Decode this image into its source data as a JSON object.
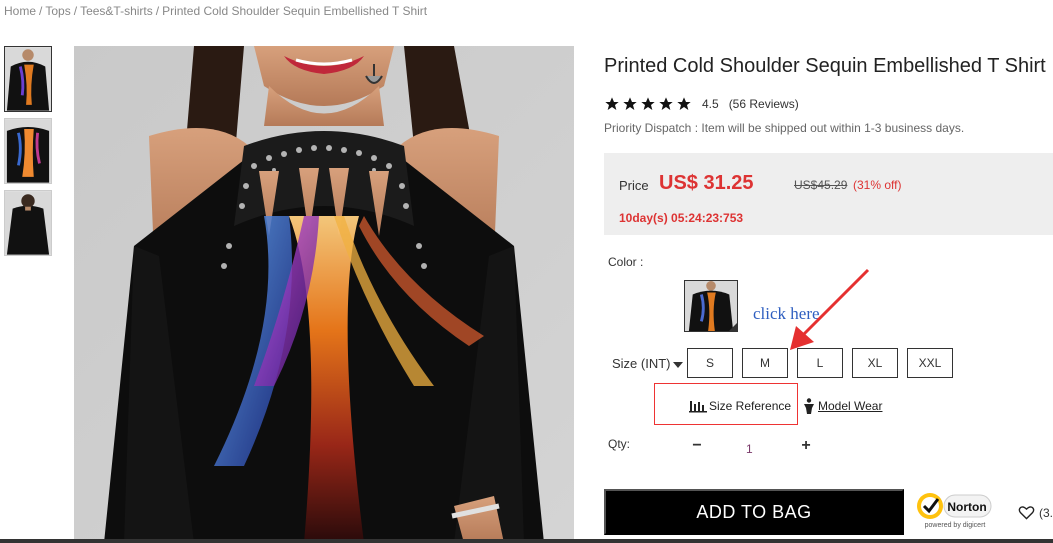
{
  "breadcrumb": {
    "items": [
      "Home",
      "Tops",
      "Tees&T-shirts",
      "Printed Cold Shoulder Sequin Embellished T Shirt"
    ],
    "separator": "/"
  },
  "product": {
    "title": "Printed Cold Shoulder Sequin Embellished T Shirt",
    "rating_value": 4.5,
    "rating_text": "4.5",
    "reviews_text": "(56 Reviews)",
    "star_count": 5,
    "dispatch": "Priority Dispatch : Item will be shipped out within 1-3 business days."
  },
  "price": {
    "label": "Price",
    "current": "US$ 31.25",
    "original": "US$45.29",
    "discount": "(31% off)",
    "countdown": "10day(s) 05:24:23:753",
    "accent_color": "#d33333"
  },
  "color": {
    "label": "Color :",
    "annotation": "click here",
    "annotation_color": "#2f5fc0",
    "arrow_color": "#e53030"
  },
  "size": {
    "label": "Size (INT)",
    "options": [
      "S",
      "M",
      "L",
      "XL",
      "XXL"
    ],
    "size_reference": "Size Reference",
    "model_wear": "Model Wear"
  },
  "quantity": {
    "label": "Qty:",
    "minus": "−",
    "value": "1",
    "plus": "+"
  },
  "actions": {
    "add_to_bag": "ADD TO BAG",
    "wishlist_count": "(3."
  },
  "badge": {
    "norton_name": "Norton",
    "norton_sub": "powered by digicert"
  },
  "icons": {
    "star": "star-icon",
    "size_chart": "bar-chart-icon",
    "model": "person-icon",
    "heart": "heart-icon",
    "check": "checkmark-icon"
  }
}
